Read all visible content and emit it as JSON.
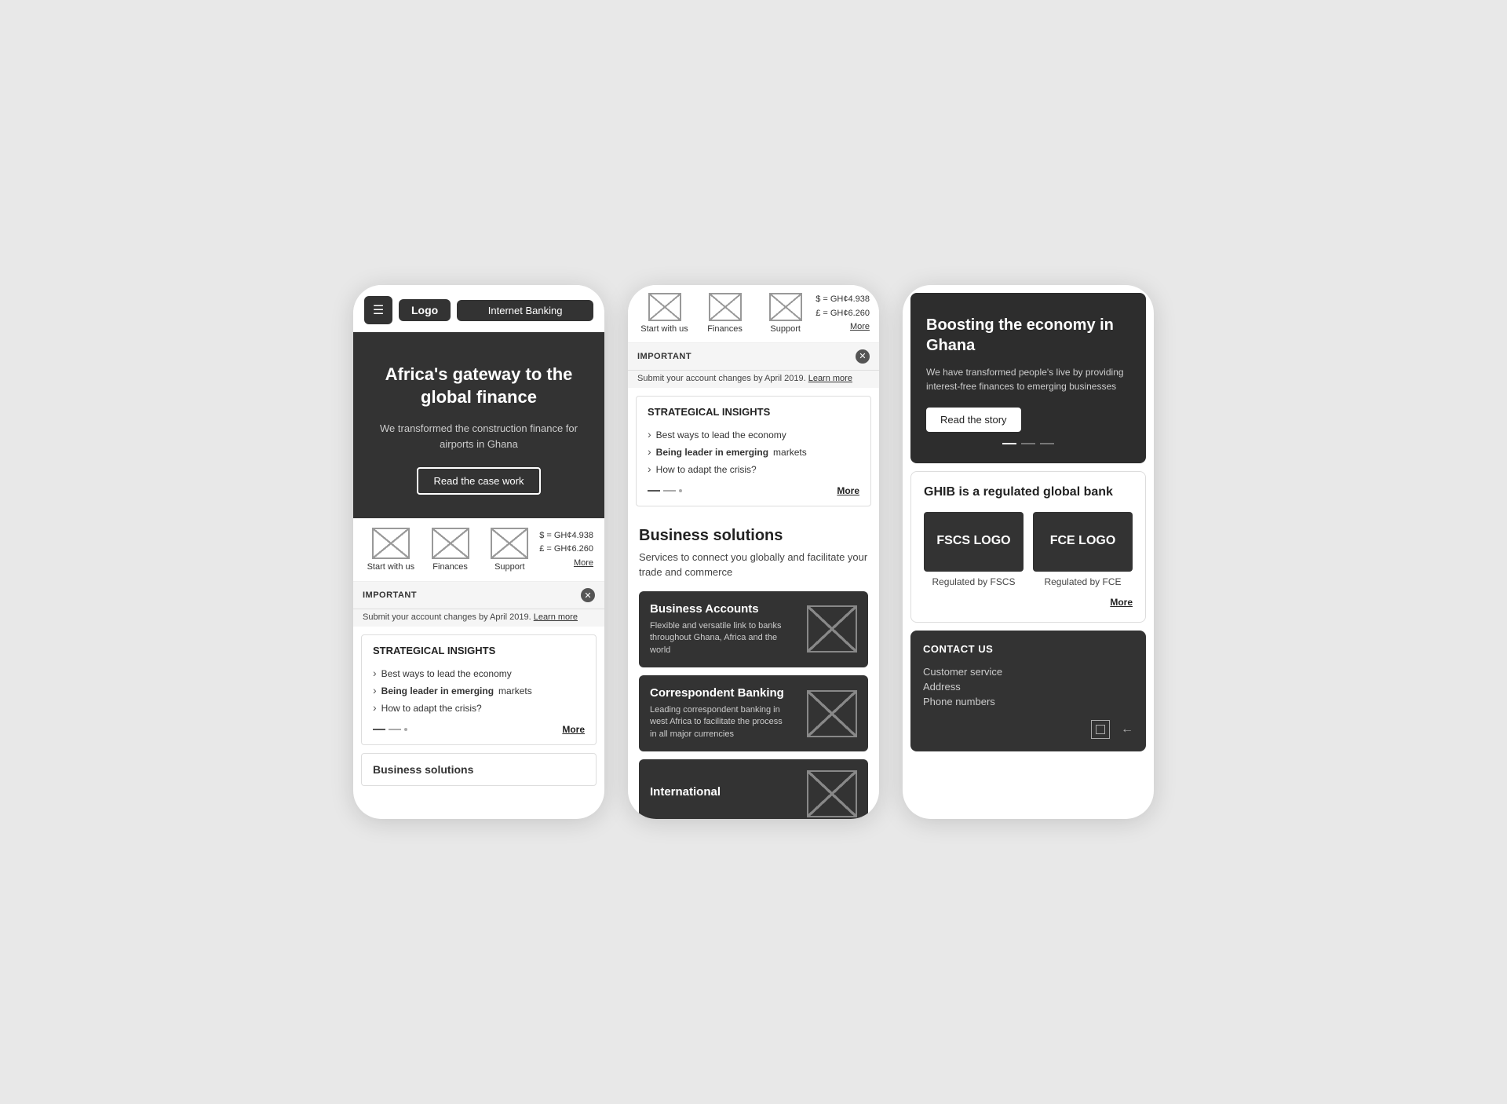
{
  "phone1": {
    "header": {
      "menu_label": "☰",
      "logo_label": "Logo",
      "internet_banking_label": "Internet Banking"
    },
    "hero": {
      "title": "Africa's gateway to the global finance",
      "subtitle": "We transformed the construction finance for airports in Ghana",
      "cta_label": "Read the case work"
    },
    "nav_items": [
      {
        "label": "Start with us"
      },
      {
        "label": "Finances"
      },
      {
        "label": "Support"
      }
    ],
    "rates": {
      "line1": "$ = GH¢4.938",
      "line2": "£ = GH¢6.260",
      "more": "More"
    },
    "important": {
      "label": "IMPORTANT",
      "text": "Submit your account changes by April 2019.",
      "learn_more": "Learn more"
    },
    "insights": {
      "title": "STRATEGICAL INSIGHTS",
      "items": [
        {
          "text": "Best ways to lead the economy"
        },
        {
          "text": "Being leader in emerging markets",
          "bold_part": "Being leader in emerging"
        },
        {
          "text": "How to adapt the crisis?"
        }
      ],
      "more": "More"
    },
    "bottom_preview": "Business solutions"
  },
  "phone2": {
    "nav_items": [
      {
        "label": "Start with us"
      },
      {
        "label": "Finances"
      },
      {
        "label": "Support"
      }
    ],
    "rates": {
      "line1": "$ = GH¢4.938",
      "line2": "£ = GH¢6.260",
      "more": "More"
    },
    "important": {
      "label": "IMPORTANT",
      "text": "Submit your account changes by April 2019.",
      "learn_more": "Learn more"
    },
    "insights": {
      "title": "STRATEGICAL INSIGHTS",
      "items": [
        {
          "text": "Best ways to lead the economy"
        },
        {
          "text": "Being leader in emerging markets"
        },
        {
          "text": "How to adapt the crisis?"
        }
      ],
      "more": "More"
    },
    "business_solutions": {
      "title": "Business solutions",
      "subtitle": "Services to connect you globally and facilitate your trade and commerce"
    },
    "cards": [
      {
        "title": "Business Accounts",
        "desc": "Flexible and versatile link to banks throughout Ghana, Africa and the world"
      },
      {
        "title": "Correspondent Banking",
        "desc": "Leading correspondent banking in west Africa to facilitate the process in all major currencies"
      },
      {
        "title": "International",
        "desc": ""
      }
    ]
  },
  "phone3": {
    "hero": {
      "title": "Boosting the economy in Ghana",
      "desc": "We have transformed people's live by providing interest-free finances to emerging businesses",
      "cta_label": "Read the story"
    },
    "regulated": {
      "title": "GHIB is a regulated global bank",
      "logo1_text": "FSCS LOGO",
      "logo1_label": "Regulated by FSCS",
      "logo2_text": "FCE LOGO",
      "logo2_label": "Regulated by FCE",
      "more": "More"
    },
    "contact": {
      "title": "CONTACT US",
      "items": [
        "Customer service",
        "Address",
        "Phone numbers"
      ]
    }
  }
}
